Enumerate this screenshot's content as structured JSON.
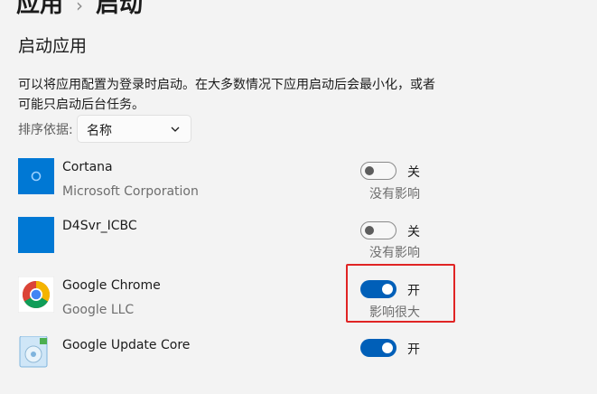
{
  "breadcrumb": {
    "parent": "应用",
    "separator": "›",
    "current": "启动"
  },
  "section_title": "启动应用",
  "description": "可以将应用配置为登录时启动。在大多数情况下应用启动后会最小化，或者可能只启动后台任务。",
  "sort": {
    "label": "排序依据:",
    "selected": "名称"
  },
  "apps": [
    {
      "name": "Cortana",
      "publisher": "Microsoft Corporation",
      "state": "关",
      "enabled": false,
      "impact": "没有影响",
      "icon": "cortana-icon"
    },
    {
      "name": "D4Svr_ICBC",
      "publisher": "",
      "state": "关",
      "enabled": false,
      "impact": "没有影响",
      "icon": "d4svr-icbc-icon"
    },
    {
      "name": "Google Chrome",
      "publisher": "Google LLC",
      "state": "开",
      "enabled": true,
      "impact": "影响很大",
      "icon": "chrome-icon"
    },
    {
      "name": "Google Update Core",
      "publisher": "",
      "state": "开",
      "enabled": true,
      "impact": "",
      "icon": "google-update-icon"
    }
  ],
  "colors": {
    "accent": "#005fb8",
    "highlight_box": "#e02424",
    "tile_blue": "#0078d4"
  }
}
